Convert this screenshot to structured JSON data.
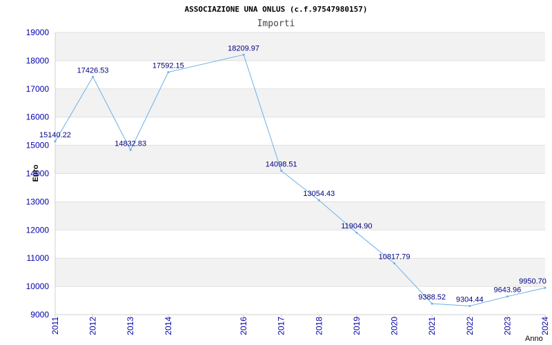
{
  "colors": {
    "background": "#ffffff",
    "band_gray": "#f2f2f2",
    "grid": "#e0e0e0",
    "axis": "#d0d0d0",
    "line": "#6ab0e8",
    "text_title": "#000000",
    "text_subtitle": "#444444",
    "tick_text": "#0000aa",
    "data_label": "#000080"
  },
  "chart_data": {
    "type": "line",
    "title": "ASSOCIAZIONE UNA ONLUS (c.f.97547980157)",
    "subtitle": "Importi",
    "xlabel": "Anno",
    "ylabel": "Euro",
    "ylim": [
      9000,
      19000
    ],
    "yticks": [
      9000,
      10000,
      11000,
      12000,
      13000,
      14000,
      15000,
      16000,
      17000,
      18000,
      19000
    ],
    "xlim": [
      2011,
      2024
    ],
    "xticks": [
      2011,
      2012,
      2013,
      2014,
      2016,
      2017,
      2018,
      2019,
      2020,
      2021,
      2022,
      2023,
      2024
    ],
    "grid": true,
    "legend": "none",
    "series": [
      {
        "points": [
          {
            "x": 2011,
            "y": 15140.22,
            "label": "15140.22"
          },
          {
            "x": 2012,
            "y": 17426.53,
            "label": "17426.53"
          },
          {
            "x": 2013,
            "y": 14832.83,
            "label": "14832.83"
          },
          {
            "x": 2014,
            "y": 17592.15,
            "label": "17592.15"
          },
          {
            "x": 2016,
            "y": 18209.97,
            "label": "18209.97"
          },
          {
            "x": 2017,
            "y": 14098.51,
            "label": "14098.51"
          },
          {
            "x": 2018,
            "y": 13054.43,
            "label": "13054.43"
          },
          {
            "x": 2019,
            "y": 11904.9,
            "label": "11904.90"
          },
          {
            "x": 2020,
            "y": 10817.79,
            "label": "10817.79"
          },
          {
            "x": 2021,
            "y": 9388.52,
            "label": "9388.52"
          },
          {
            "x": 2022,
            "y": 9304.44,
            "label": "9304.44"
          },
          {
            "x": 2023,
            "y": 9643.96,
            "label": "9643.96"
          },
          {
            "x": 2024,
            "y": 9950.7,
            "label": "9950.70"
          }
        ]
      }
    ]
  }
}
